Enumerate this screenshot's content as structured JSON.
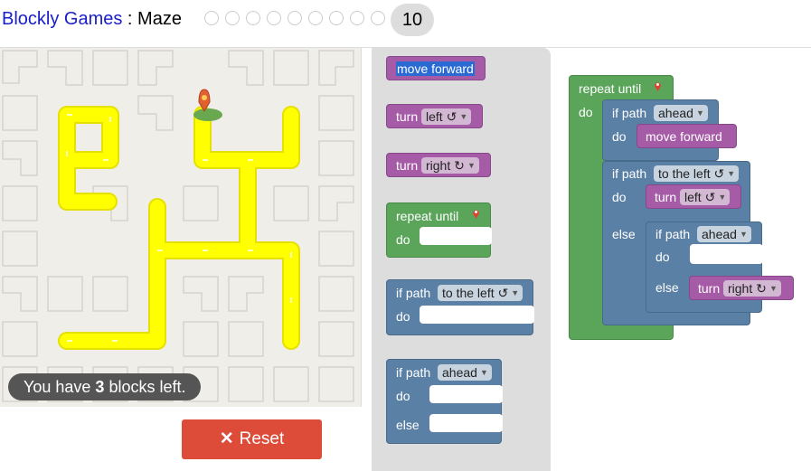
{
  "header": {
    "app_name": "Blockly Games",
    "separator": " : ",
    "game_name": "Maze",
    "current_level": "10",
    "level_count": 10
  },
  "maze": {
    "message_prefix": "You have ",
    "blocks_left": "3",
    "message_suffix": " blocks left.",
    "path_color": "#ffff00",
    "background_color": "#f0eee9"
  },
  "reset_button": {
    "icon": "close-icon",
    "label": "Reset",
    "color": "#dd4b39"
  },
  "toolbox": {
    "move_forward": "move forward",
    "turn_left": {
      "label": "turn",
      "value": "left ↺"
    },
    "turn_right": {
      "label": "turn",
      "value": "right ↻"
    },
    "repeat_until": {
      "label": "repeat until",
      "do": "do"
    },
    "if_path_left": {
      "label": "if path",
      "value": "to the left ↺",
      "do": "do"
    },
    "if_path_ahead_else": {
      "label": "if path",
      "value": "ahead",
      "do": "do",
      "else": "else"
    }
  },
  "workspace": {
    "repeat_until": "repeat until",
    "repeat_do": "do",
    "if1": {
      "label": "if path",
      "value": "ahead",
      "do": "do",
      "action": "move forward"
    },
    "if2": {
      "label": "if path",
      "value": "to the left ↺",
      "do": "do",
      "action_label": "turn",
      "action_value": "left ↺",
      "else": "else"
    },
    "if3": {
      "label": "if path",
      "value": "ahead",
      "do": "do",
      "else": "else",
      "action_label": "turn",
      "action_value": "right ↻"
    }
  },
  "colors": {
    "motion": "#a55ba5",
    "loops": "#5ba55b",
    "logic": "#5b80a5"
  }
}
